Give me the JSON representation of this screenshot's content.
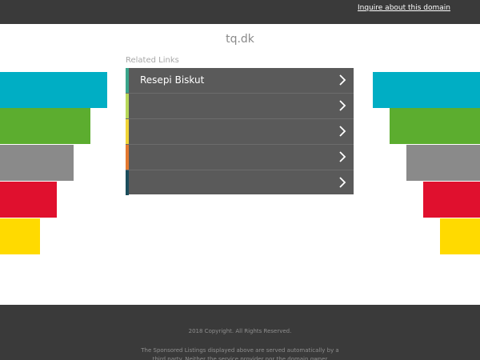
{
  "header": {
    "inquire_link": "Inquire about this domain"
  },
  "domain": "tq.dk",
  "related_links_label": "Related Links",
  "links": [
    {
      "label": "Resepi Biskut",
      "accent": "#3aa58b"
    },
    {
      "label": "",
      "accent": "#b7d85a"
    },
    {
      "label": "",
      "accent": "#f0d436"
    },
    {
      "label": "",
      "accent": "#e4782f"
    },
    {
      "label": "",
      "accent": "#1b4d5c"
    }
  ],
  "decor_colors": [
    "#00aec4",
    "#5cad2f",
    "#8a8a8a",
    "#e0102e",
    "#ffda00"
  ],
  "footer": {
    "copyright": "2018 Copyright. All Rights Reserved.",
    "disclaimer": "The Sponsored Listings displayed above are served automatically by a third party. Neither the service provider nor the domain owner"
  }
}
